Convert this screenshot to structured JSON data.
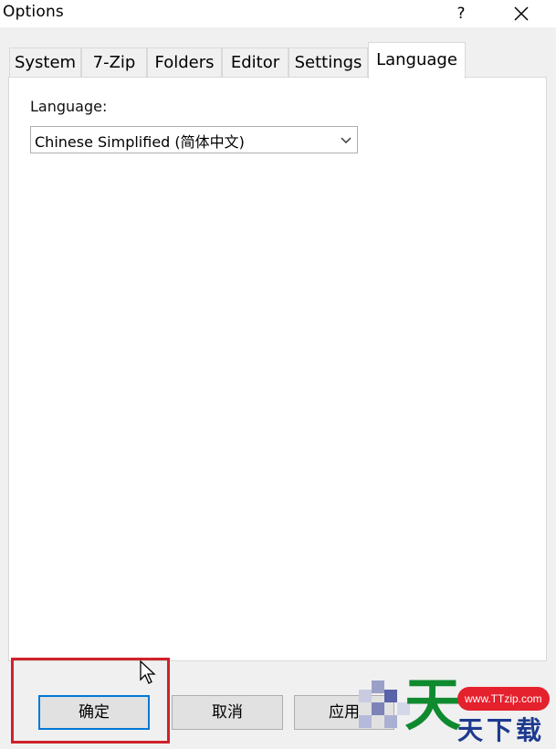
{
  "window": {
    "title": "Options",
    "help_label": "?",
    "close_label": "✕"
  },
  "tabs": [
    {
      "label": "System"
    },
    {
      "label": "7-Zip"
    },
    {
      "label": "Folders"
    },
    {
      "label": "Editor"
    },
    {
      "label": "Settings"
    },
    {
      "label": "Language",
      "active": true
    }
  ],
  "language_panel": {
    "label": "Language:",
    "selected_value": "Chinese Simplified (简体中文)"
  },
  "buttons": {
    "ok_label": "确定",
    "cancel_label": "取消",
    "apply_label": "应用"
  },
  "watermark": {
    "url": "www.TTzip.com",
    "big_char": "天",
    "small_text": "天下载"
  },
  "colors": {
    "highlight_border": "#d0212b",
    "focus_border": "#0078d7",
    "watermark_green": "#0f8a2f",
    "watermark_red": "#e5212d",
    "watermark_blue": "#1d3a8f"
  },
  "icons": [
    "close-icon",
    "help-icon",
    "chevron-down-icon",
    "mouse-cursor-icon"
  ]
}
